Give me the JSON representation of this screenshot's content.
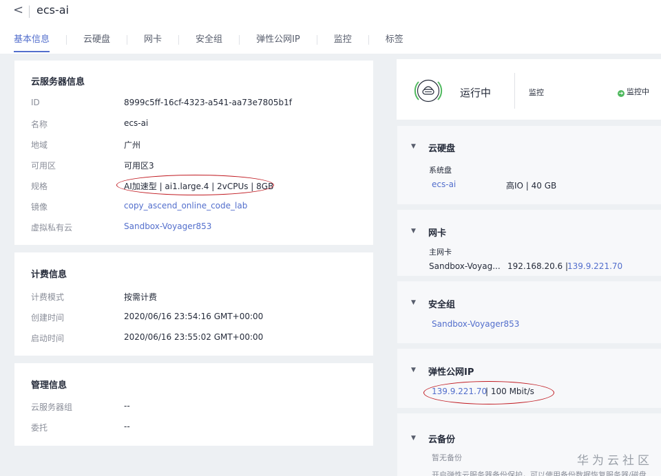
{
  "header": {
    "back_glyph": "<",
    "title": "ecs-ai"
  },
  "tabs": [
    {
      "label": "基本信息",
      "active": true
    },
    {
      "label": "云硬盘"
    },
    {
      "label": "网卡"
    },
    {
      "label": "安全组"
    },
    {
      "label": "弹性公网IP"
    },
    {
      "label": "监控"
    },
    {
      "label": "标签"
    }
  ],
  "server_info": {
    "title": "云服务器信息",
    "rows": [
      {
        "label": "ID",
        "value": "8999c5ff-16cf-4323-a541-aa73e7805b1f"
      },
      {
        "label": "名称",
        "value": "ecs-ai"
      },
      {
        "label": "地域",
        "value": "广州"
      },
      {
        "label": "可用区",
        "value": "可用区3"
      },
      {
        "label": "规格",
        "value": "AI加速型 | ai1.large.4 | 2vCPUs | 8GB"
      },
      {
        "label": "镜像",
        "value": "copy_ascend_online_code_lab"
      },
      {
        "label": "虚拟私有云",
        "value": "Sandbox-Voyager853"
      }
    ]
  },
  "billing_info": {
    "title": "计费信息",
    "rows": [
      {
        "label": "计费模式",
        "value": "按需计费"
      },
      {
        "label": "创建时间",
        "value": "2020/06/16 23:54:16 GMT+00:00"
      },
      {
        "label": "启动时间",
        "value": "2020/06/16 23:55:02 GMT+00:00"
      }
    ]
  },
  "mgmt_info": {
    "title": "管理信息",
    "rows": [
      {
        "label": "云服务器组",
        "value": "--"
      },
      {
        "label": "委托",
        "value": "--"
      }
    ]
  },
  "status": {
    "state": "运行中",
    "monitor_label": "监控",
    "monitor_status": "监控中"
  },
  "disk": {
    "title": "云硬盘",
    "subtitle": "系统盘",
    "name": "ecs-ai",
    "spec": "高IO | 40 GB"
  },
  "nic": {
    "title": "网卡",
    "subtitle": "主网卡",
    "name": "Sandbox-Voyag...",
    "private_ip": "192.168.20.6 |",
    "public_ip": "139.9.221.70"
  },
  "security_group": {
    "title": "安全组",
    "name": "Sandbox-Voyager853"
  },
  "eip": {
    "title": "弹性公网IP",
    "ip": "139.9.221.70",
    "bandwidth": "| 100 Mbit/s"
  },
  "backup": {
    "title": "云备份",
    "status": "暂无备份",
    "hint": "开启弹性云服务器备份保护，可以使用备份数据恢复服务器/磁盘"
  },
  "watermark": "华为云社区",
  "colors": {
    "accent": "#526ecc",
    "annotation": "#c0181f",
    "running": "#50b95f"
  }
}
